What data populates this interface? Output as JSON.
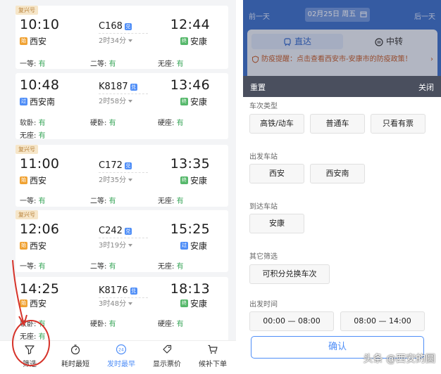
{
  "trains": [
    {
      "badge": "复兴号",
      "dep_time": "10:10",
      "train": "C168",
      "duration": "2时34分",
      "arr_time": "12:44",
      "dep_station": "西安",
      "dep_icon": "始",
      "arr_station": "安康",
      "arr_icon": "终",
      "seats": [
        {
          "label": "一等:",
          "avail": "有"
        },
        {
          "label": "二等:",
          "avail": "有"
        },
        {
          "label": "无座:",
          "avail": "有"
        }
      ]
    },
    {
      "badge": "",
      "dep_time": "10:48",
      "train": "K8187",
      "duration": "2时58分",
      "arr_time": "13:46",
      "dep_station": "西安南",
      "dep_icon": "过",
      "arr_station": "安康",
      "arr_icon": "终",
      "seats": [
        {
          "label": "软卧:",
          "avail": "有"
        },
        {
          "label": "硬卧:",
          "avail": "有"
        },
        {
          "label": "硬座:",
          "avail": "有"
        },
        {
          "label": "无座:",
          "avail": "有"
        }
      ]
    },
    {
      "badge": "复兴号",
      "dep_time": "11:00",
      "train": "C172",
      "duration": "2时35分",
      "arr_time": "13:35",
      "dep_station": "西安",
      "dep_icon": "始",
      "arr_station": "安康",
      "arr_icon": "终",
      "seats": [
        {
          "label": "一等:",
          "avail": "有"
        },
        {
          "label": "二等:",
          "avail": "有"
        },
        {
          "label": "无座:",
          "avail": "有"
        }
      ]
    },
    {
      "badge": "复兴号",
      "dep_time": "12:06",
      "train": "C242",
      "duration": "3时19分",
      "arr_time": "15:25",
      "dep_station": "西安",
      "dep_icon": "始",
      "arr_station": "安康",
      "arr_icon": "过",
      "seats": [
        {
          "label": "一等:",
          "avail": "有"
        },
        {
          "label": "二等:",
          "avail": "有"
        },
        {
          "label": "无座:",
          "avail": "有"
        }
      ]
    },
    {
      "badge": "",
      "dep_time": "14:25",
      "train": "K8176",
      "duration": "3时48分",
      "arr_time": "18:13",
      "dep_station": "西安",
      "dep_icon": "始",
      "arr_station": "安康",
      "arr_icon": "终",
      "seats": [
        {
          "label": "软卧:",
          "avail": "有"
        },
        {
          "label": "硬卧:",
          "avail": "有"
        },
        {
          "label": "硬座:",
          "avail": "有"
        },
        {
          "label": "无座:",
          "avail": "有"
        }
      ]
    }
  ],
  "dui_label": "兑",
  "tabbar": {
    "filter": "筛选",
    "shortest": "耗时最短",
    "earliest": "发时最早",
    "price": "显示票价",
    "waitlist": "候补下单",
    "clock_text": "24"
  },
  "right": {
    "prev_day": "前一天",
    "next_day": "后一天",
    "date": "02月25日 周五",
    "mode_direct": "直达",
    "mode_transfer": "中转",
    "notice": "防疫提醒：点击查看西安市-安康市的防疫政策！",
    "reset": "重置",
    "close": "关闭",
    "type_title": "车次类型",
    "type_opts": [
      "高铁/动车",
      "普通车",
      "只看有票"
    ],
    "dep_title": "出发车站",
    "dep_opts": [
      "西安",
      "西安南"
    ],
    "arr_title": "到达车站",
    "arr_opts": [
      "安康"
    ],
    "other_title": "其它筛选",
    "other_opts": [
      "可积分兑换车次"
    ],
    "time_title": "出发时间",
    "time_opts": [
      "00:00 — 08:00",
      "08:00 — 14:00"
    ],
    "confirm": "确认",
    "watermark": "头条 @西安的圆"
  },
  "colors": {
    "accent": "#4f8ef7",
    "available": "#3aa65a",
    "annotation": "#d6332a",
    "header_blue": "#3b6fc9"
  }
}
